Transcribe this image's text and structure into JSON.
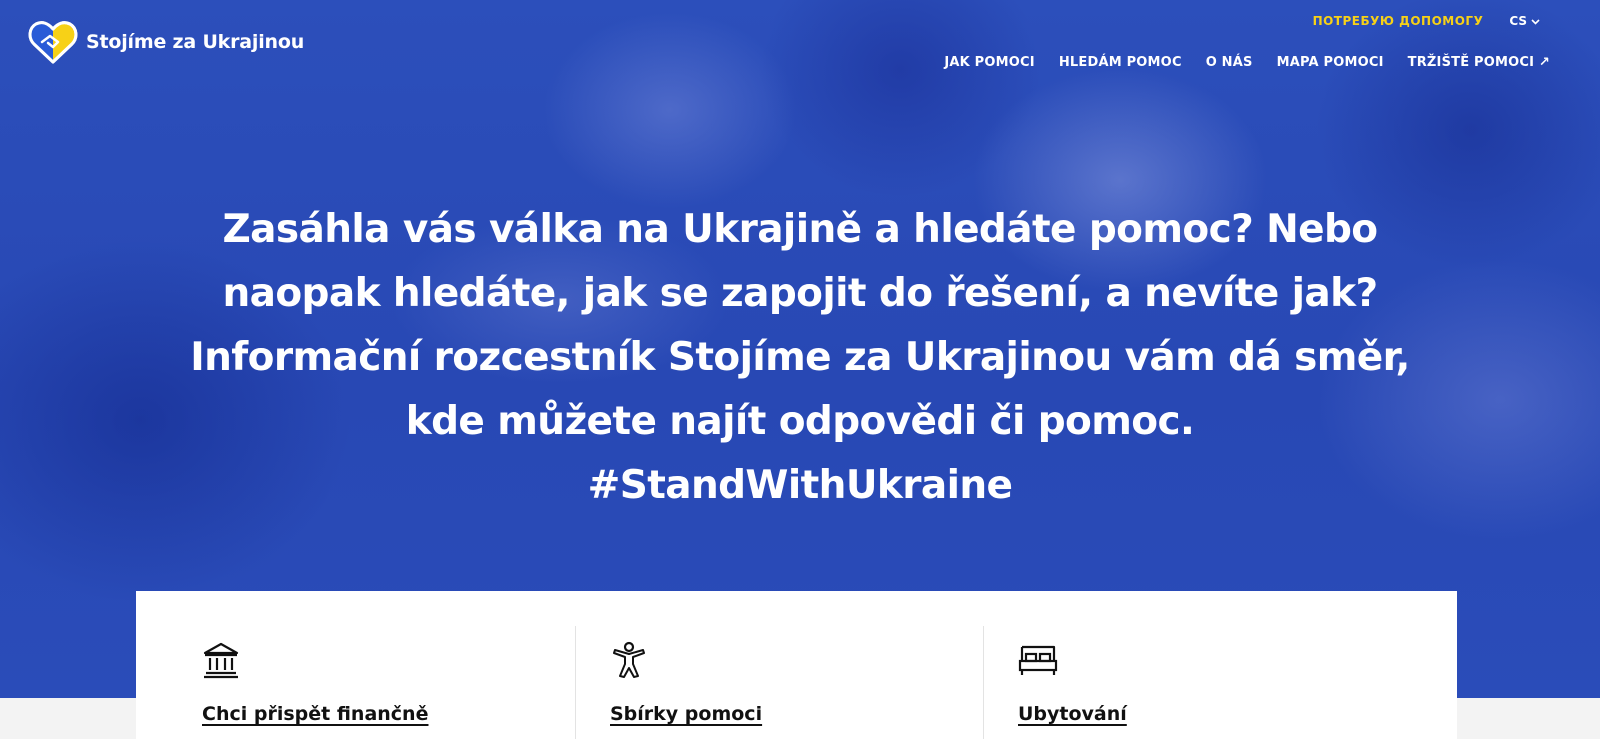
{
  "brand": {
    "name": "Stojíme za Ukrajinou",
    "colors": {
      "blue": "#2a4cb8",
      "yellow": "#f7d117",
      "white": "#ffffff"
    },
    "logo_icon": "heart-handshake-icon"
  },
  "header": {
    "need_help": "ПОТРЕБУЮ ДОПОМОГУ",
    "language": "CS",
    "nav": [
      {
        "label": "JAK POMOCI"
      },
      {
        "label": "HLEDÁM POMOC"
      },
      {
        "label": "O NÁS"
      },
      {
        "label": "MAPA POMOCI"
      },
      {
        "label": "TRŽIŠTĚ POMOCI ↗"
      }
    ]
  },
  "hero": {
    "headline": "Zasáhla vás válka na Ukrajině a hledáte pomoc? Nebo naopak hledáte, jak se zapojit do řešení, a nevíte jak? Informační rozcestník Stojíme za Ukrajinou vám dá směr, kde můžete najít odpovědi či pomoc.",
    "hashtag": "#StandWithUkraine"
  },
  "cards": [
    {
      "icon": "bank-icon",
      "label": "Chci přispět finančně"
    },
    {
      "icon": "person-icon",
      "label": "Sbírky pomoci"
    },
    {
      "icon": "bed-icon",
      "label": "Ubytování"
    }
  ]
}
